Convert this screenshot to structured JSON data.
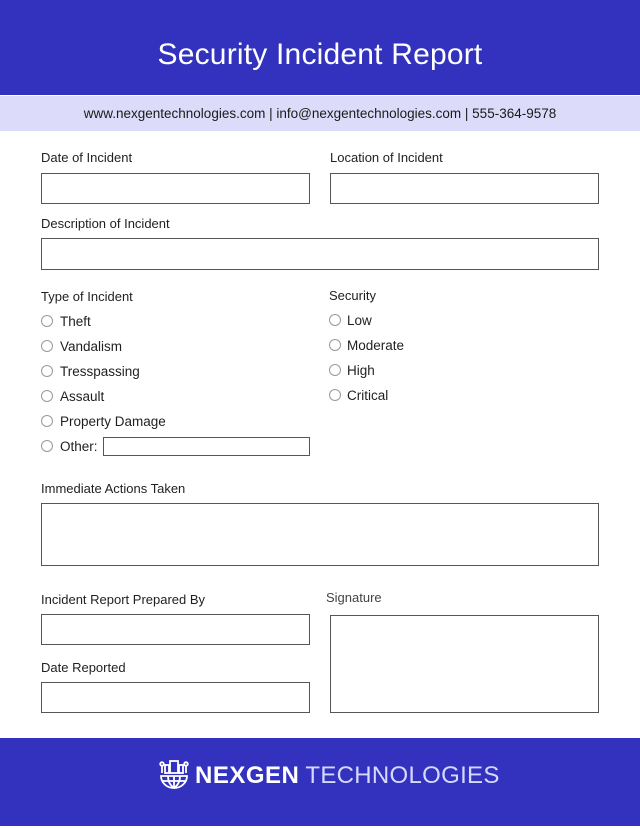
{
  "header": {
    "title": "Security Incident Report",
    "color": "#3232bf"
  },
  "contact": {
    "website": "www.nexgentechnologies.com",
    "email": "info@nexgentechnologies.com",
    "phone": "555-364-9578",
    "line": "www.nexgentechnologies.com | info@nexgentechnologies.com | 555-364-9578"
  },
  "form": {
    "date_of_incident": {
      "label": "Date of Incident",
      "value": ""
    },
    "location_of_incident": {
      "label": "Location of Incident",
      "value": ""
    },
    "description_of_incident": {
      "label": "Description of Incident",
      "value": ""
    },
    "type_of_incident": {
      "label": "Type of Incident",
      "options": [
        "Theft",
        "Vandalism",
        "Tresspassing",
        "Assault",
        "Property Damage",
        "Other:"
      ],
      "other_value": ""
    },
    "security": {
      "label": "Security",
      "options": [
        "Low",
        "Moderate",
        "High",
        "Critical"
      ]
    },
    "immediate_actions": {
      "label": "Immediate Actions Taken",
      "value": ""
    },
    "prepared_by": {
      "label": "Incident Report Prepared By",
      "value": ""
    },
    "date_reported": {
      "label": "Date Reported",
      "value": ""
    },
    "signature": {
      "label": "Signature"
    }
  },
  "footer": {
    "brand_bold": "NEXGEN",
    "brand_light": "TECHNOLOGIES",
    "logo_icon": "globe-buildings-icon"
  }
}
